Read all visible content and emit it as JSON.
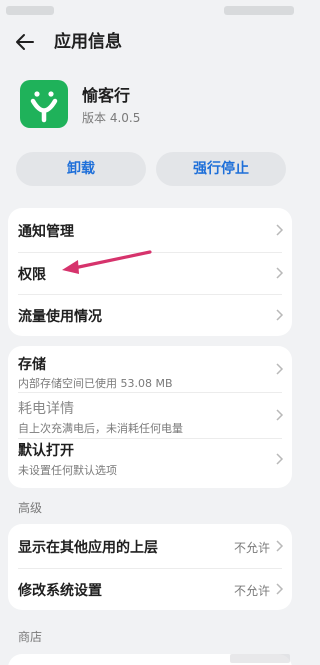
{
  "header": {
    "title": "应用信息",
    "back_icon": "arrow-left-icon"
  },
  "app": {
    "name": "愉客行",
    "version": "版本 4.0.5",
    "icon": "app-logo-icon",
    "icon_color": "#1fb25a"
  },
  "actions": {
    "uninstall": "卸载",
    "force_stop": "强行停止",
    "accent": "#1e6fd9"
  },
  "group1": {
    "notification": "通知管理",
    "permissions": "权限",
    "data_usage": "流量使用情况"
  },
  "group2": {
    "storage_title": "存储",
    "storage_sub": "内部存储空间已使用 53.08 MB",
    "battery_title": "耗电详情",
    "battery_sub": "自上次充满电后，未消耗任何电量",
    "default_open_title": "默认打开",
    "default_open_sub": "未设置任何默认选项"
  },
  "advanced": {
    "section_label": "高级",
    "overlay_label": "显示在其他应用的上层",
    "overlay_value": "不允许",
    "modify_settings_label": "修改系统设置",
    "modify_settings_value": "不允许"
  },
  "store": {
    "section_label": "商店"
  },
  "annotation": {
    "arrow_color": "#d6336c"
  }
}
